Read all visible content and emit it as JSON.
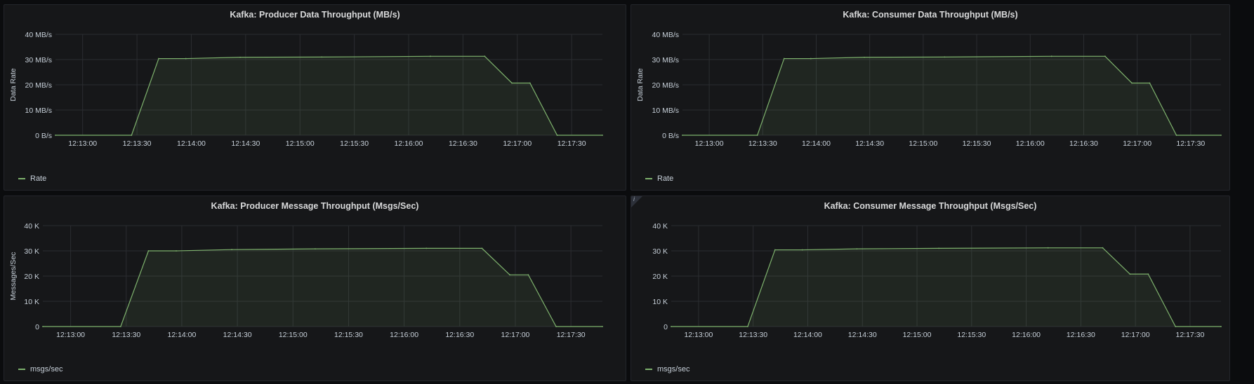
{
  "colors": {
    "series": "#7eb26d",
    "fill": "rgba(126,178,109,0.10)"
  },
  "chart_data": [
    {
      "type": "area",
      "title": "Kafka: Producer Data Throughput (MB/s)",
      "ylabel": "Data Rate",
      "ylim": [
        0,
        40
      ],
      "y_ticks": [
        "0 B/s",
        "10 MB/s",
        "20 MB/s",
        "30 MB/s",
        "40 MB/s"
      ],
      "y_tick_values": [
        0,
        10,
        20,
        30,
        40
      ],
      "x_ticks": [
        "12:13:00",
        "12:13:30",
        "12:14:00",
        "12:14:30",
        "12:15:00",
        "12:15:30",
        "12:16:00",
        "12:16:30",
        "12:17:00",
        "12:17:30"
      ],
      "x_range": [
        "12:12:45",
        "12:17:47"
      ],
      "legend": "Rate",
      "series": [
        {
          "name": "Rate",
          "x": [
            "12:12:45",
            "12:13:27",
            "12:13:42",
            "12:13:57",
            "12:14:27",
            "12:15:12",
            "12:16:12",
            "12:16:42",
            "12:16:57",
            "12:17:07",
            "12:17:22",
            "12:17:47"
          ],
          "values": [
            0,
            0,
            30.4,
            30.4,
            30.9,
            31.0,
            31.3,
            31.3,
            20.7,
            20.7,
            0,
            0
          ]
        }
      ]
    },
    {
      "type": "area",
      "title": "Kafka: Consumer Data Throughput (MB/s)",
      "ylabel": "Data Rate",
      "ylim": [
        0,
        40
      ],
      "y_ticks": [
        "0 B/s",
        "10 MB/s",
        "20 MB/s",
        "30 MB/s",
        "40 MB/s"
      ],
      "y_tick_values": [
        0,
        10,
        20,
        30,
        40
      ],
      "x_ticks": [
        "12:13:00",
        "12:13:30",
        "12:14:00",
        "12:14:30",
        "12:15:00",
        "12:15:30",
        "12:16:00",
        "12:16:30",
        "12:17:00",
        "12:17:30"
      ],
      "x_range": [
        "12:12:45",
        "12:17:47"
      ],
      "legend": "Rate",
      "series": [
        {
          "name": "Rate",
          "x": [
            "12:12:45",
            "12:13:27",
            "12:13:42",
            "12:13:57",
            "12:14:27",
            "12:15:12",
            "12:16:12",
            "12:16:42",
            "12:16:57",
            "12:17:07",
            "12:17:22",
            "12:17:47"
          ],
          "values": [
            0,
            0,
            30.4,
            30.4,
            30.9,
            31.0,
            31.3,
            31.3,
            20.7,
            20.7,
            0,
            0
          ]
        }
      ]
    },
    {
      "type": "area",
      "title": "Kafka: Producer Message Throughput (Msgs/Sec)",
      "ylabel": "Messages/Sec",
      "ylim": [
        0,
        40000
      ],
      "y_ticks": [
        "0",
        "10 K",
        "20 K",
        "30 K",
        "40 K"
      ],
      "y_tick_values": [
        0,
        10000,
        20000,
        30000,
        40000
      ],
      "x_ticks": [
        "12:13:00",
        "12:13:30",
        "12:14:00",
        "12:14:30",
        "12:15:00",
        "12:15:30",
        "12:16:00",
        "12:16:30",
        "12:17:00",
        "12:17:30"
      ],
      "x_range": [
        "12:12:45",
        "12:17:47"
      ],
      "legend": "msgs/sec",
      "series": [
        {
          "name": "msgs/sec",
          "x": [
            "12:12:45",
            "12:13:27",
            "12:13:42",
            "12:13:57",
            "12:14:27",
            "12:15:12",
            "12:16:12",
            "12:16:42",
            "12:16:57",
            "12:17:07",
            "12:17:22",
            "12:17:47"
          ],
          "values": [
            0,
            0,
            30000,
            30000,
            30500,
            30800,
            31000,
            31000,
            20500,
            20500,
            0,
            0
          ]
        }
      ]
    },
    {
      "type": "area",
      "title": "Kafka: Consumer Message Throughput (Msgs/Sec)",
      "ylabel": "",
      "ylim": [
        0,
        40000
      ],
      "y_ticks": [
        "0",
        "10 K",
        "20 K",
        "30 K",
        "40 K"
      ],
      "y_tick_values": [
        0,
        10000,
        20000,
        30000,
        40000
      ],
      "x_ticks": [
        "12:13:00",
        "12:13:30",
        "12:14:00",
        "12:14:30",
        "12:15:00",
        "12:15:30",
        "12:16:00",
        "12:16:30",
        "12:17:00",
        "12:17:30"
      ],
      "x_range": [
        "12:12:45",
        "12:17:47"
      ],
      "legend": "msgs/sec",
      "info_icon": "i",
      "series": [
        {
          "name": "msgs/sec",
          "x": [
            "12:12:45",
            "12:13:27",
            "12:13:42",
            "12:13:57",
            "12:14:27",
            "12:15:12",
            "12:16:12",
            "12:16:42",
            "12:16:57",
            "12:17:07",
            "12:17:22",
            "12:17:47"
          ],
          "values": [
            0,
            0,
            30400,
            30400,
            30800,
            31000,
            31200,
            31200,
            20800,
            20800,
            0,
            0
          ]
        }
      ]
    }
  ]
}
